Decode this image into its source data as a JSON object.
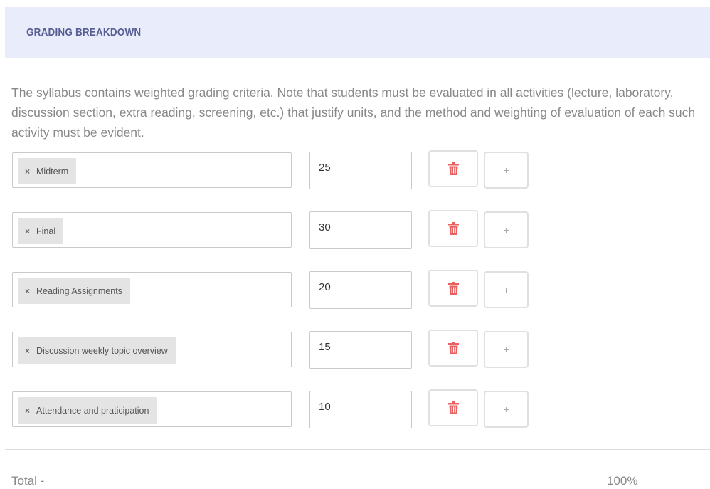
{
  "header": {
    "title": "GRADING BREAKDOWN"
  },
  "description": "The syllabus contains weighted grading criteria. Note that students must be evaluated in all activities (lecture, laboratory, discussion section, extra reading, screening, etc.) that justify units, and the method and weighting of evaluation of each such activity must be evident.",
  "criteria": [
    {
      "name": "Midterm",
      "weight": "25"
    },
    {
      "name": "Final",
      "weight": "30"
    },
    {
      "name": "Reading Assignments",
      "weight": "20"
    },
    {
      "name": "Discussion weekly topic overview",
      "weight": "15"
    },
    {
      "name": "Attendance and praticipation",
      "weight": "10"
    }
  ],
  "buttons": {
    "remove_tag_glyph": "×",
    "add_glyph": "+"
  },
  "icons": {
    "remove_tag": "close-icon",
    "delete": "trash-icon",
    "add": "plus-icon"
  },
  "colors": {
    "header_bg": "#e8ecfb",
    "header_text": "#565e93",
    "delete_icon": "#e8605f",
    "tag_bg": "#e4e4e4"
  },
  "total": {
    "label": "Total -",
    "value": "100%"
  }
}
